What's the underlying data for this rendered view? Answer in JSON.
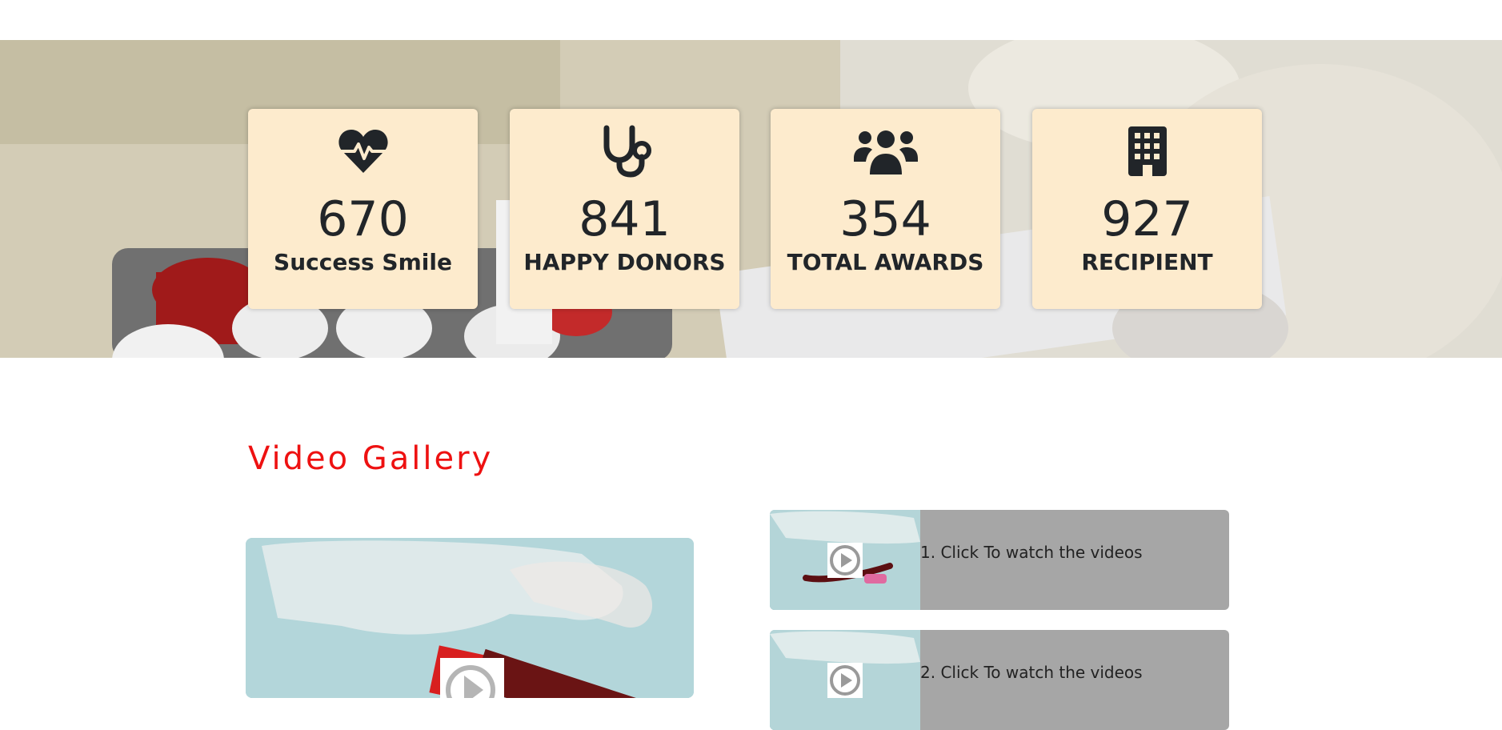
{
  "stats": [
    {
      "icon": "heart-pulse-icon",
      "number": "670",
      "label": "Success Smile"
    },
    {
      "icon": "stethoscope-icon",
      "number": "841",
      "label": "HAPPY DONORS"
    },
    {
      "icon": "users-icon",
      "number": "354",
      "label": "TOTAL AWARDS"
    },
    {
      "icon": "building-icon",
      "number": "927",
      "label": "RECIPIENT"
    }
  ],
  "gallery": {
    "title": "Video Gallery",
    "items": [
      {
        "caption": "1. Click To watch the videos"
      },
      {
        "caption": "2. Click To watch the videos"
      }
    ]
  },
  "colors": {
    "card_bg": "#fdebcd",
    "title_red": "#ee1111",
    "video_item_bg": "#a6a6a6"
  }
}
